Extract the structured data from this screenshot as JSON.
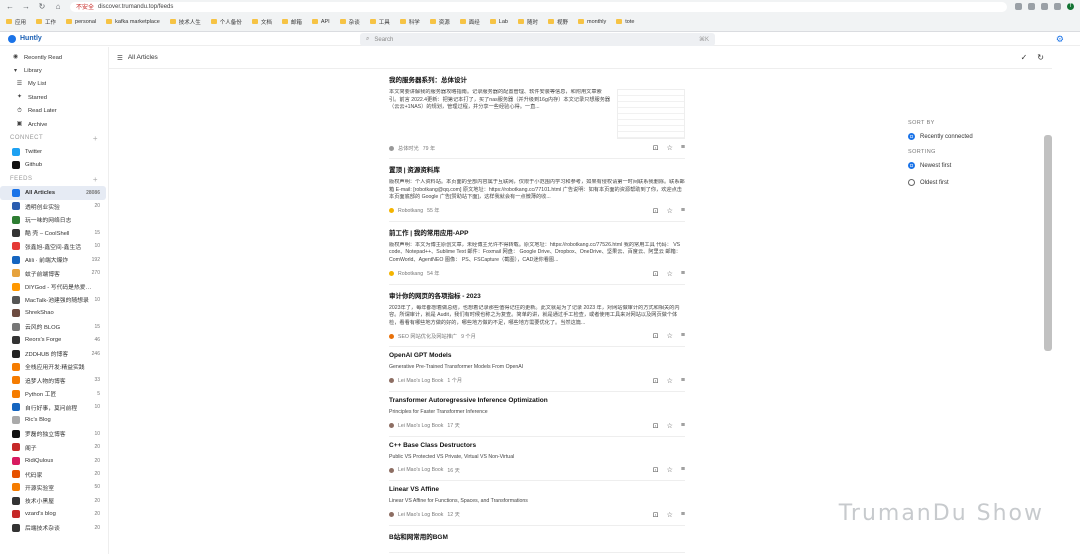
{
  "browser": {
    "url": "discover.trumandu.top/feeds",
    "security": "不安全",
    "bookmarks": [
      "应用",
      "工作",
      "personal",
      "kafka marketplace",
      "技术人生",
      "个人备份",
      "文档",
      "邮箱",
      "API",
      "杂谈",
      "工具",
      "科学",
      "资源",
      "面经",
      "Lab",
      "随时",
      "视野",
      "monthly",
      "tote"
    ]
  },
  "app": {
    "name": "Huntly",
    "search_placeholder": "Search",
    "search_shortcut": "⌘K"
  },
  "sidebar": {
    "top": [
      {
        "label": "Recently Read",
        "icon": "eye-icon"
      },
      {
        "label": "Library",
        "icon": "library-icon"
      }
    ],
    "library": [
      {
        "label": "My List"
      },
      {
        "label": "Starred"
      },
      {
        "label": "Read Later"
      },
      {
        "label": "Archive"
      }
    ],
    "connect_title": "CONNECT",
    "connect": [
      {
        "label": "Twitter",
        "color": "#1da1f2"
      },
      {
        "label": "Github",
        "color": "#111111"
      }
    ],
    "feeds_title": "FEEDS",
    "feeds": [
      {
        "label": "All Articles",
        "count": "28086",
        "color": "#1a73e8"
      },
      {
        "label": "透明创业实验",
        "count": "20",
        "color": "#2a5db0"
      },
      {
        "label": "玩一味的网络日志",
        "count": "",
        "color": "#2e7d32"
      },
      {
        "label": "酷 壳 – CoolShell",
        "count": "15",
        "color": "#333333"
      },
      {
        "label": "张鑫旭-鑫空间-鑫生活",
        "count": "10",
        "color": "#e53935"
      },
      {
        "label": "Alili · 前端大爆炸",
        "count": "192",
        "color": "#1565c0"
      },
      {
        "label": "蚊子前端博客",
        "count": "270",
        "color": "#e6a23c"
      },
      {
        "label": "DIYGod - 写代码是热爱，...",
        "count": "",
        "color": "#ff9800"
      },
      {
        "label": "MacTalk-池建强的随想录",
        "count": "10",
        "color": "#555555"
      },
      {
        "label": "ShrekShao",
        "count": "",
        "color": "#6d4c41"
      },
      {
        "label": "云风的 BLOG",
        "count": "15",
        "color": "#777777"
      },
      {
        "label": "Reorx’s Forge",
        "count": "46",
        "color": "#333333"
      },
      {
        "label": "ZDDHUB 的博客",
        "count": "246",
        "color": "#222222"
      },
      {
        "label": "全栈应用开发:精益实践",
        "count": "",
        "color": "#f57c00"
      },
      {
        "label": "追梦人物的博客",
        "count": "33",
        "color": "#f57c00"
      },
      {
        "label": "Python 工匠",
        "count": "5",
        "color": "#f57c00"
      },
      {
        "label": "自行好事，莫问前程",
        "count": "10",
        "color": "#1565c0"
      },
      {
        "label": "Ric’s Blog",
        "count": "",
        "color": "#aaaaaa"
      },
      {
        "label": "罗磊的独立博客",
        "count": "10",
        "color": "#111111"
      },
      {
        "label": "阁子",
        "count": "20",
        "color": "#c62828"
      },
      {
        "label": "RidiQulous",
        "count": "20",
        "color": "#d81b60"
      },
      {
        "label": "代码家",
        "count": "20",
        "color": "#e65100"
      },
      {
        "label": "开源实验室",
        "count": "50",
        "color": "#f57c00"
      },
      {
        "label": "技术小黑屋",
        "count": "20",
        "color": "#333333"
      },
      {
        "label": "vzard’s blog",
        "count": "20",
        "color": "#c62828"
      },
      {
        "label": "后端技术杂谈",
        "count": "20",
        "color": "#333333"
      }
    ]
  },
  "main": {
    "title": "All Articles"
  },
  "articles": [
    {
      "title": "我的服务器系列：总体设计",
      "summary": "本文简要讲解我的服务器攻略指南。记录服务器的配置管理、软件安装等信息，和附用文章索引。前言 2022.4更新：把第记本打了，买了nas服务器（并升级到16g内存）本文记录只想服务器（云云+1NAS）的规划，管理过程，并分享一些经验心得。一直...",
      "source": "总体时光",
      "time": "79 年",
      "dot": "#999999",
      "thumb": true
    },
    {
      "title": "置顶 | 资源资料库",
      "summary": "版权声明：个人资料站。本页面的全部内容属于互联网，仅限于小范围内学习和参考，如果有侵权请第一时间联系我删除。联系邮箱 E-mail: [robotkang@qq.com] 原文地址：https://robotkang.cc/77101.html 广告说明：如有本页面的资源帮助到了你，欢迎点击本页面底部的 Google 广告[赞助站下面]，这样我就会有一点微薄的收...",
      "source": "Robotkang",
      "time": "55 年",
      "dot": "#f4b400"
    },
    {
      "title": "前工作 | 我的常用应用-APP",
      "summary": "版权声明：本文为博主原创文章，未经博主允许不得转载。原文地址：https://robotkang.cc/77526.html 我的常用工具 代码： VS code、Notepad++、Sublime Text 邮件：Foxmail 网盘： Google Drive、Dropbox、OneDrive、坚果云、百度云、阿里云 邮箱： ComWorld、AgentNEO 图像： PS、FSCapture（截图），CAD迷你看图...",
      "source": "Robotkang",
      "time": "54 年",
      "dot": "#f4b400"
    },
    {
      "title": "审计你的网页的各项指标 - 2023",
      "summary": "2023年了，每年都想着做总结，也想着记录那些值得记住的更新。此文就是为了记录 2023 年，对网站做审计的方式和相关的内容。所谓审计，就是 Audit，我们有时候也称之为复查。简单的讲，就是通过手工检查，或者使用工具来对网站以及网页做个体检，看看有哪些地方做的好的，哪些地方做的不足，哪些地方需要优化了。当然这篇...",
      "source": "SEO 网站优化及网站推广",
      "time": "9 个月",
      "dot": "#e8710a"
    },
    {
      "title": "OpenAI GPT Models",
      "summary": "Generative Pre-Trained Transformer Models From OpenAI",
      "source": "Lei Mao's Log Book",
      "time": "1 个月",
      "dot": "#8d6e63"
    },
    {
      "title": "Transformer Autoregressive Inference Optimization",
      "summary": "Principles for Faster Transformer Inference",
      "source": "Lei Mao's Log Book",
      "time": "17 天",
      "dot": "#8d6e63"
    },
    {
      "title": "C++ Base Class Destructors",
      "summary": "Public VS Protected VS Private, Virtual VS Non-Virtual",
      "source": "Lei Mao's Log Book",
      "time": "16 天",
      "dot": "#8d6e63"
    },
    {
      "title": "Linear VS Affine",
      "summary": "Linear VS Affine for Functions, Spaces, and Transformations",
      "source": "Lei Mao's Log Book",
      "time": "12 天",
      "dot": "#8d6e63"
    },
    {
      "title": "B站和网常用的BGM",
      "summary": "",
      "source": "",
      "time": "",
      "dot": "#999999"
    }
  ],
  "panel": {
    "sort_by": "SORT BY",
    "sort_by_option": "Recently connected",
    "sorting": "SORTING",
    "options": [
      "Newest first",
      "Oldest first"
    ],
    "selected": "Newest first"
  },
  "watermark": "TrumanDu Show"
}
